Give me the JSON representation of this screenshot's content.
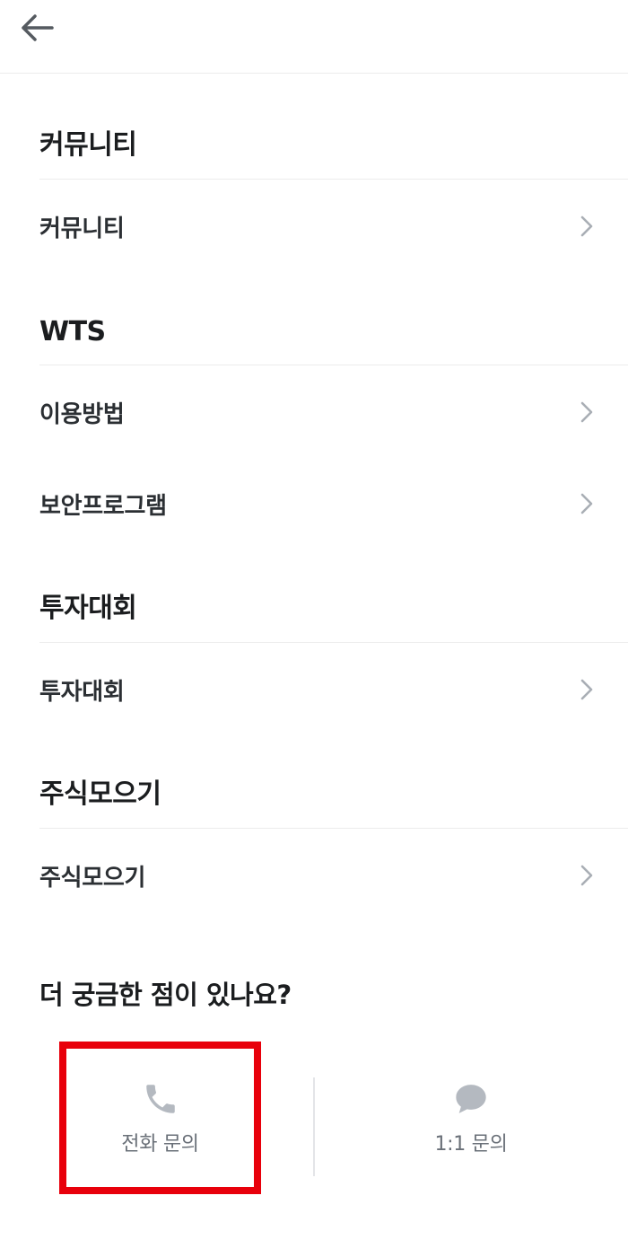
{
  "header": {
    "back_icon": "arrow-left-icon"
  },
  "sections": [
    {
      "title": "커뮤니티",
      "items": [
        {
          "label": "커뮤니티"
        }
      ]
    },
    {
      "title": "WTS",
      "items": [
        {
          "label": "이용방법"
        },
        {
          "label": "보안프로그램"
        }
      ]
    },
    {
      "title": "투자대회",
      "items": [
        {
          "label": "투자대회"
        }
      ]
    },
    {
      "title": "주식모으기",
      "items": [
        {
          "label": "주식모으기"
        }
      ]
    }
  ],
  "help": {
    "question": "더 궁금한 점이 있나요?",
    "phone": {
      "label": "전화 문의",
      "icon": "phone-icon"
    },
    "chat": {
      "label": "1:1 문의",
      "icon": "chat-bubble-icon"
    }
  },
  "colors": {
    "highlight_border": "#e8000b",
    "icon_gray": "#b4b9c0",
    "chevron_gray": "#a9aeb5"
  }
}
